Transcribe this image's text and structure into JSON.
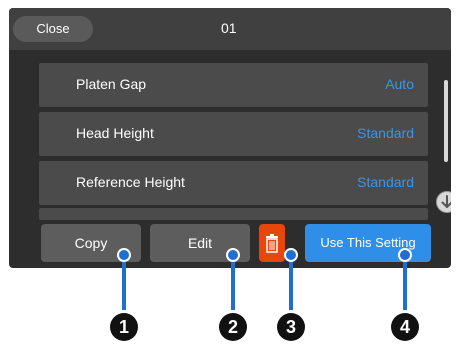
{
  "header": {
    "close_label": "Close",
    "title": "01"
  },
  "settings": [
    {
      "label": "Platen Gap",
      "value": "Auto"
    },
    {
      "label": "Head Height",
      "value": "Standard"
    },
    {
      "label": "Reference Height",
      "value": "Standard"
    }
  ],
  "actions": {
    "copy_label": "Copy",
    "edit_label": "Edit",
    "use_label": "Use This Setting"
  },
  "callouts": [
    "1",
    "2",
    "3",
    "4"
  ],
  "colors": {
    "accent_value": "#3c94ea",
    "primary_button": "#2f8ee8",
    "delete_button": "#e8460b",
    "callout_line": "#1f6fd0"
  },
  "icons": {
    "scroll": "down-arrow-circle-icon",
    "delete": "trash-icon"
  }
}
